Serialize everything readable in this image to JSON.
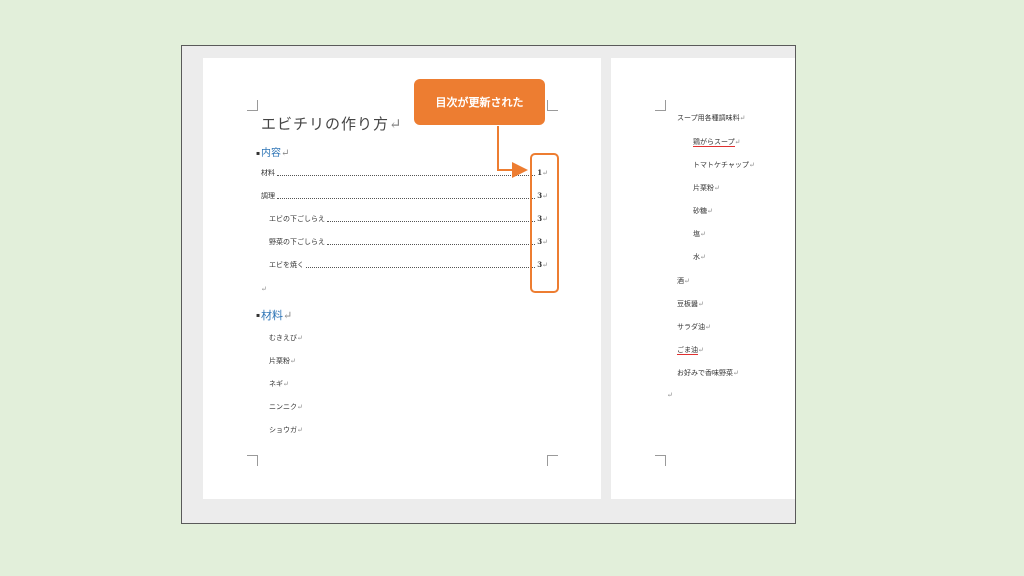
{
  "page1": {
    "title": "エビチリの作り方",
    "toc_heading": "内容",
    "toc": [
      {
        "label": "材料",
        "page": "1",
        "indent": false
      },
      {
        "label": "調理",
        "page": "3",
        "indent": false
      },
      {
        "label": "エビの下ごしらえ",
        "page": "3",
        "indent": true
      },
      {
        "label": "野菜の下ごしらえ",
        "page": "3",
        "indent": true
      },
      {
        "label": "エビを焼く",
        "page": "3",
        "indent": true
      }
    ],
    "materials_heading": "材料",
    "materials": [
      "むきえび",
      "片栗粉",
      "ネギ",
      "ニンニク",
      "ショウガ"
    ]
  },
  "page2": {
    "sub_heading": "スープ用各種調味料",
    "sub_items": [
      "鶏がらスープ",
      "トマトケチャップ",
      "片栗粉",
      "砂糖",
      "塩",
      "水"
    ],
    "items": [
      "酒",
      "豆板醤",
      "サラダ油",
      "ごま油",
      "お好みで香味野菜"
    ]
  },
  "marks": {
    "paragraph": "↵",
    "bullet": "▪"
  },
  "callout": {
    "text": "目次が更新された"
  },
  "colors": {
    "accent": "#ed7d31",
    "heading": "#2e75b6",
    "background": "#e2efda"
  }
}
